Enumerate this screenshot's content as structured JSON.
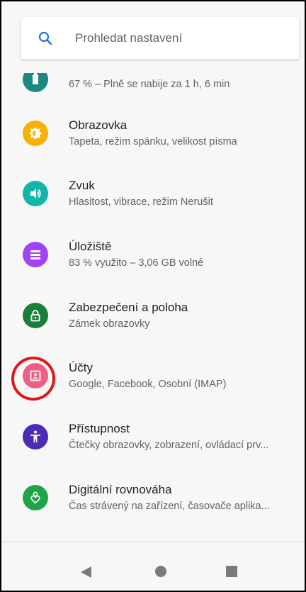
{
  "search": {
    "placeholder": "Prohledat nastavení",
    "icon": "search-icon"
  },
  "settings": {
    "items": [
      {
        "id": "battery",
        "title": "",
        "subtitle": "67 % – Plně se nabije za 1 h, 6 min",
        "icon": "battery-icon",
        "color": "#1a8a7e"
      },
      {
        "id": "display",
        "title": "Obrazovka",
        "subtitle": "Tapeta, režim spánku, velikost písma",
        "icon": "brightness-icon",
        "color": "#f8b100"
      },
      {
        "id": "sound",
        "title": "Zvuk",
        "subtitle": "Hlasitost, vibrace, režim Nerušit",
        "icon": "volume-icon",
        "color": "#12b5a8"
      },
      {
        "id": "storage",
        "title": "Úložiště",
        "subtitle": "83 % využito – 3,06 GB volné",
        "icon": "storage-icon",
        "color": "#a142f4"
      },
      {
        "id": "security",
        "title": "Zabezpečení a poloha",
        "subtitle": "Zámek obrazovky",
        "icon": "lock-icon",
        "color": "#188038"
      },
      {
        "id": "accounts",
        "title": "Účty",
        "subtitle": "Google, Facebook, Osobní (IMAP)",
        "icon": "account-icon",
        "color": "#f05e85"
      },
      {
        "id": "accessibility",
        "title": "Přístupnost",
        "subtitle": "Čtečky obrazovky, zobrazení, ovládací prv...",
        "icon": "accessibility-icon",
        "color": "#4c2bb5"
      },
      {
        "id": "wellbeing",
        "title": "Digitální rovnováha",
        "subtitle": "Čas strávený na zařízení, časovače aplika...",
        "icon": "wellbeing-icon",
        "color": "#1ea446"
      }
    ]
  },
  "annotation": {
    "highlight_color": "#e2151a",
    "target": "accounts"
  },
  "navbar": {
    "buttons": [
      "back-icon",
      "home-icon",
      "recents-icon"
    ],
    "color": "#7a7a7a"
  }
}
